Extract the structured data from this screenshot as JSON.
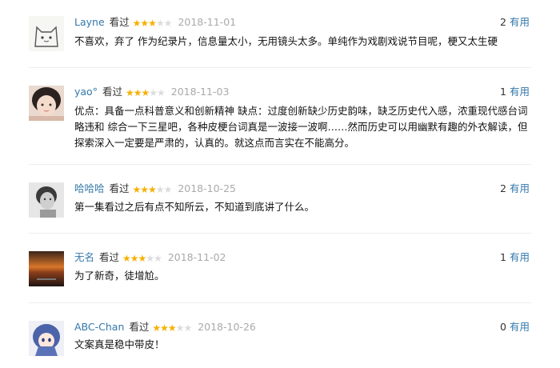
{
  "comments": [
    {
      "user": "Layne",
      "watched_label": "看过",
      "rating": 3,
      "max_rating": 5,
      "date": "2018-11-01",
      "votes": "2",
      "vote_label": "有用",
      "text": "不喜欢，弃了 作为纪录片，信息量太小，无用镜头太多。单纯作为戏剧戏说节目呢，梗又太生硬",
      "avatar_icon": "cat-drawing-avatar"
    },
    {
      "user": "yao°",
      "watched_label": "看过",
      "rating": 3,
      "max_rating": 5,
      "date": "2018-11-03",
      "votes": "1",
      "vote_label": "有用",
      "text": "优点：具备一点科普意义和创新精神 缺点：过度创新缺少历史韵味，缺乏历史代入感，浓重现代感台词略违和 综合一下三星吧，各种皮梗台词真是一波接一波啊……然而历史可以用幽默有趣的外衣解读，但探索深入一定要是严肃的，认真的。就这点而言实在不能高分。",
      "avatar_icon": "girl-photo-avatar"
    },
    {
      "user": "哈哈哈",
      "watched_label": "看过",
      "rating": 3,
      "max_rating": 5,
      "date": "2018-10-25",
      "votes": "2",
      "vote_label": "有用",
      "text": "第一集看过之后有点不知所云，不知道到底讲了什么。",
      "avatar_icon": "grayscale-portrait-avatar"
    },
    {
      "user": "无名",
      "watched_label": "看过",
      "rating": 3,
      "max_rating": 5,
      "date": "2018-11-02",
      "votes": "1",
      "vote_label": "有用",
      "text": "为了新奇，徒增尬。",
      "avatar_icon": "sunset-landscape-avatar"
    },
    {
      "user": "ABC-Chan",
      "watched_label": "看过",
      "rating": 3,
      "max_rating": 5,
      "date": "2018-10-26",
      "votes": "0",
      "vote_label": "有用",
      "text": "文案真是稳中带皮！",
      "avatar_icon": "anime-girl-avatar"
    }
  ],
  "colors": {
    "username": "#3377aa",
    "star": "#f6b000",
    "star_empty": "#dcdcdc",
    "date": "#aaaaaa",
    "divider": "#eeeeee"
  }
}
